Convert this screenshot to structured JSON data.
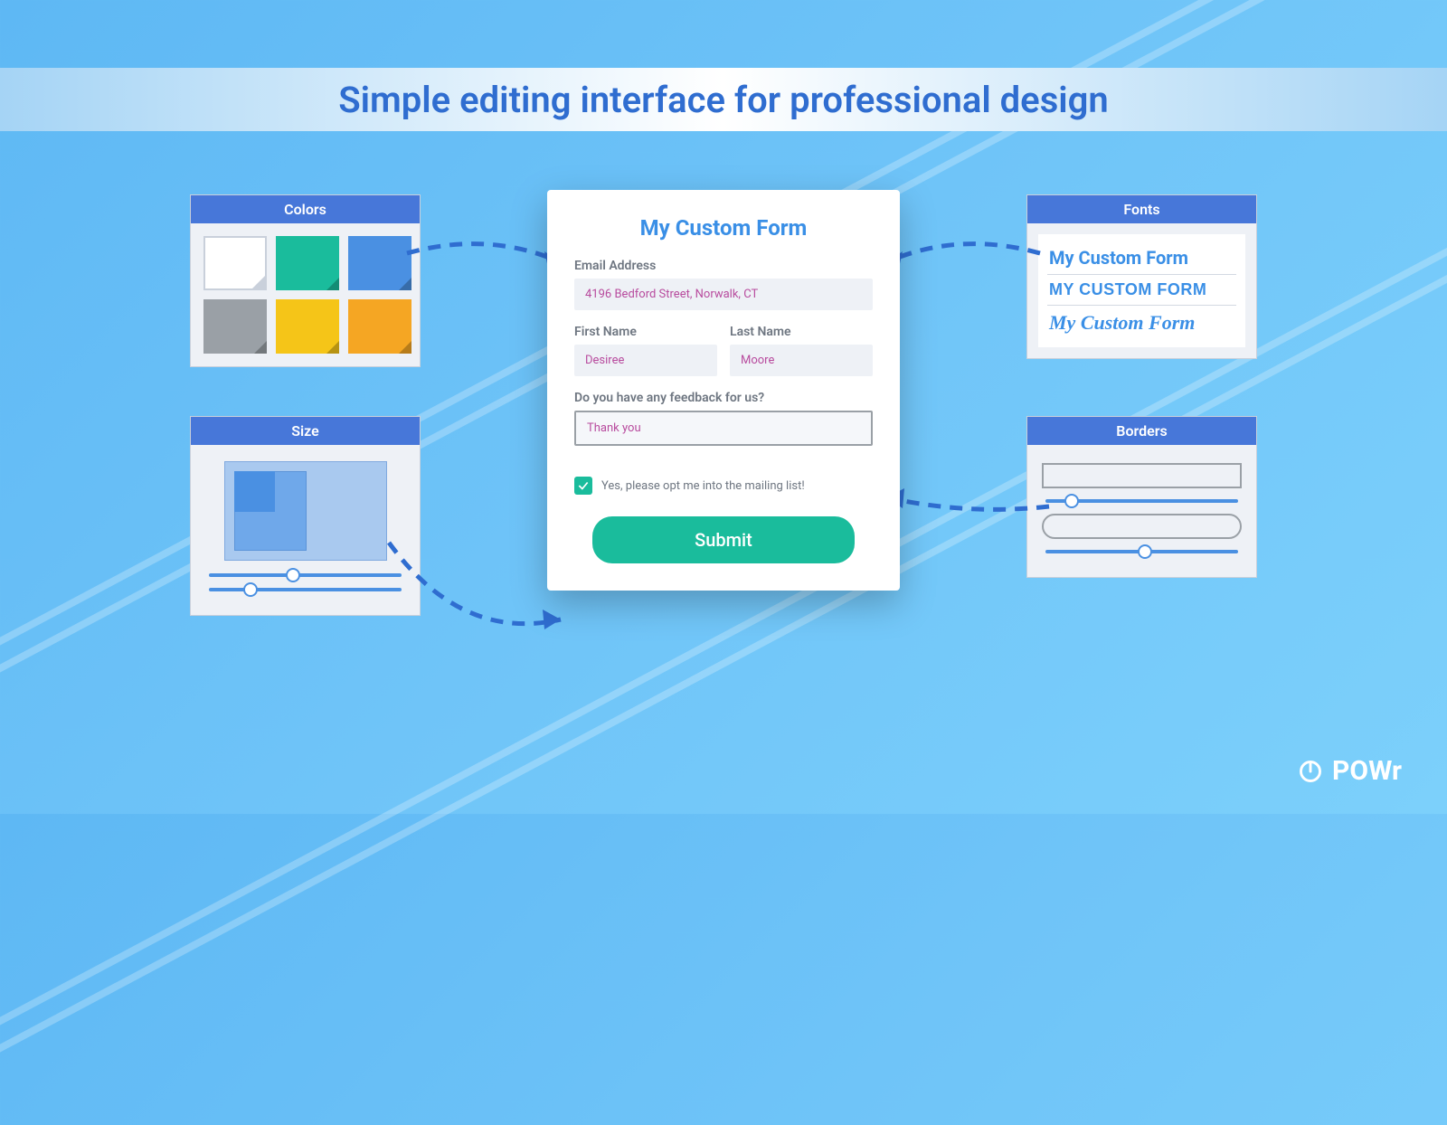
{
  "header": {
    "title": "Simple editing interface for professional design"
  },
  "panels": {
    "colors": {
      "title": "Colors",
      "swatches": [
        "white",
        "green",
        "blue",
        "gray",
        "yellow",
        "orange"
      ]
    },
    "size": {
      "title": "Size",
      "slider1_percent": 40,
      "slider2_percent": 18
    },
    "fonts": {
      "title": "Fonts",
      "samples": [
        "My Custom Form",
        "MY CUSTOM FORM",
        "My Custom Form"
      ]
    },
    "borders": {
      "title": "Borders",
      "slider1_percent": 10,
      "slider2_percent": 48
    }
  },
  "form": {
    "title": "My Custom Form",
    "email_label": "Email Address",
    "email_value": "4196 Bedford Street, Norwalk, CT",
    "first_name_label": "First Name",
    "first_name_value": "Desiree",
    "last_name_label": "Last Name",
    "last_name_value": "Moore",
    "feedback_label": "Do you have any feedback for us?",
    "feedback_value": "Thank you",
    "opt_in_checked": true,
    "opt_in_label": "Yes, please opt me into the mailing list!",
    "submit_label": "Submit"
  },
  "brand": {
    "name": "POWr"
  }
}
